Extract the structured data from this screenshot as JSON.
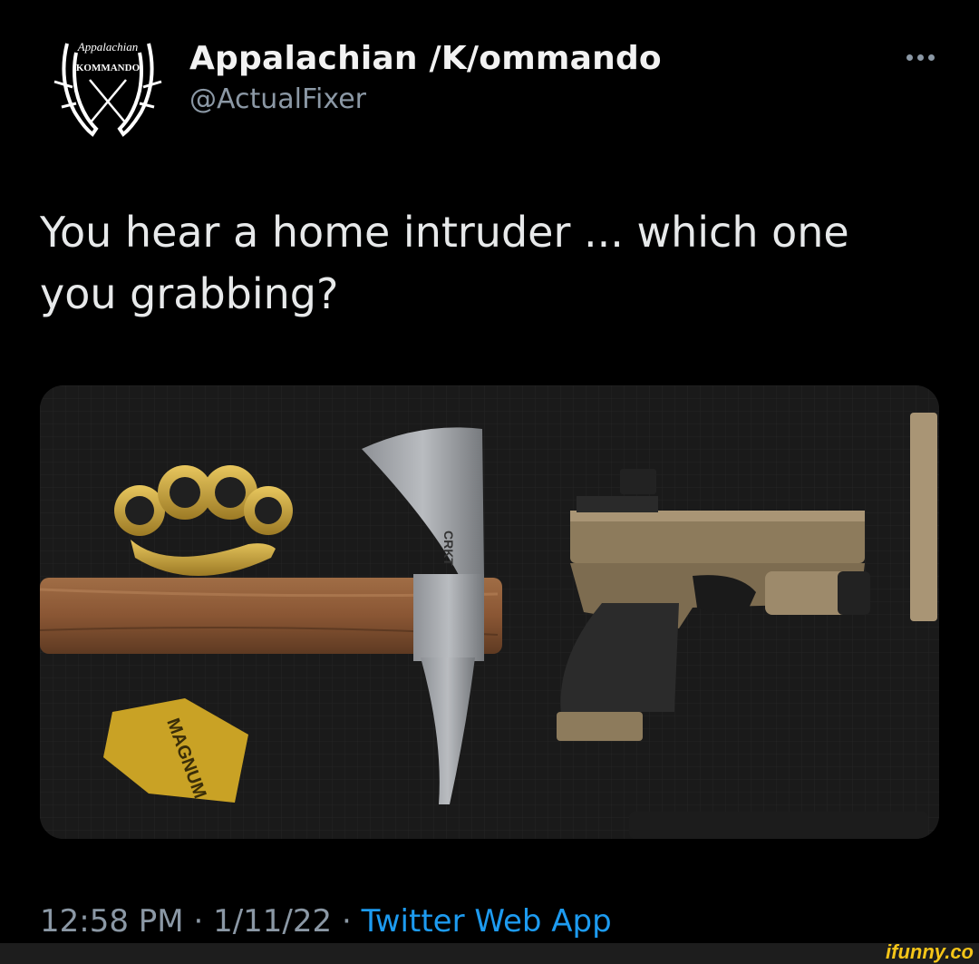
{
  "tweet": {
    "display_name": "Appalachian /K/ommando",
    "handle": "@ActualFixer",
    "avatar": {
      "top_text": "Appalachian",
      "bottom_text": "KOMMANDO"
    },
    "more_label": "More",
    "text_line1": "You hear a home intruder ... which one",
    "text_line2": "you grabbing?",
    "photo": {
      "axe_brand": "CRKT",
      "wrapper_text": "MAGNUM"
    },
    "time": "12:58 PM",
    "separator1": "·",
    "date": "1/11/22",
    "separator2": "·",
    "app": "Twitter Web App"
  },
  "watermark": "ifunny.co",
  "colors": {
    "background": "#000000",
    "text": "#e7e9ea",
    "secondary": "#8b98a5",
    "link": "#1d9bf0",
    "watermark": "#f5c518"
  }
}
